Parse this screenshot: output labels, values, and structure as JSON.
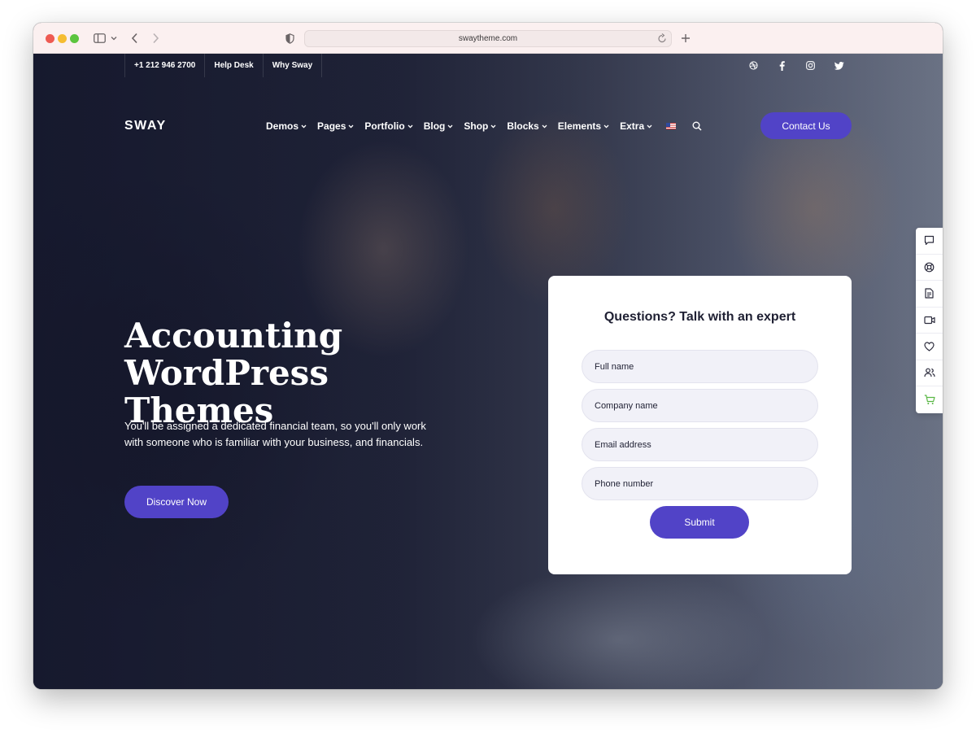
{
  "browser": {
    "url": "swaytheme.com"
  },
  "topbar": {
    "items": [
      "+1 212 946 2700",
      "Help Desk",
      "Why Sway"
    ],
    "socials": [
      "dribbble-icon",
      "facebook-icon",
      "instagram-icon",
      "twitter-icon"
    ]
  },
  "header": {
    "logo": "SWAY",
    "nav": [
      "Demos",
      "Pages",
      "Portfolio",
      "Blog",
      "Shop",
      "Blocks",
      "Elements",
      "Extra"
    ],
    "contact_label": "Contact Us"
  },
  "hero": {
    "title_line1": "Accounting WordPress",
    "title_line2": "Themes",
    "subtitle_line1": "You'll be assigned a dedicated financial team, so you'll only work",
    "subtitle_line2": "with someone who is familiar with your business, and financials.",
    "cta_label": "Discover Now"
  },
  "form": {
    "title": "Questions? Talk with an expert",
    "fields": [
      {
        "placeholder": "Full name"
      },
      {
        "placeholder": "Company name"
      },
      {
        "placeholder": "Email address"
      },
      {
        "placeholder": "Phone number"
      }
    ],
    "submit_label": "Submit"
  },
  "side_dock": {
    "icons": [
      "chat-icon",
      "lifebuoy-icon",
      "document-icon",
      "video-icon",
      "heart-icon",
      "users-icon",
      "cart-icon"
    ]
  },
  "colors": {
    "accent": "#5143c7",
    "cart_green": "#59b744"
  }
}
